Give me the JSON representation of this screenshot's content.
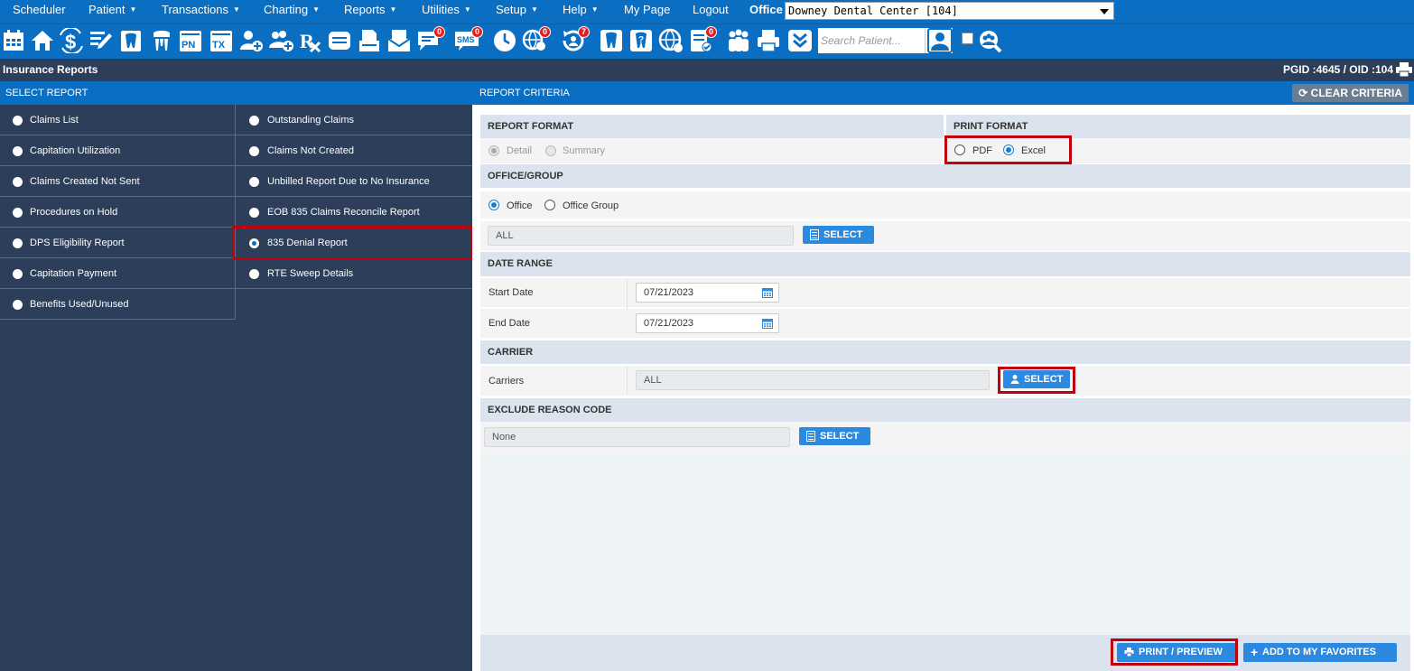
{
  "nav": {
    "items": [
      {
        "label": "Scheduler",
        "caret": false
      },
      {
        "label": "Patient",
        "caret": true
      },
      {
        "label": "Transactions",
        "caret": true
      },
      {
        "label": "Charting",
        "caret": true
      },
      {
        "label": "Reports",
        "caret": true
      },
      {
        "label": "Utilities",
        "caret": true
      },
      {
        "label": "Setup",
        "caret": true
      },
      {
        "label": "Help",
        "caret": true
      },
      {
        "label": "My Page",
        "caret": false
      },
      {
        "label": "Logout",
        "caret": false
      }
    ],
    "office_label": "Office",
    "office_value": "Downey Dental Center [104]"
  },
  "toolbar": {
    "badges": {
      "messages": "0",
      "sms": "0",
      "web": "0",
      "recall": "7",
      "docs": "0"
    },
    "search_placeholder": "Search Patient..."
  },
  "page": {
    "title": "Insurance Reports",
    "pgid_oid": "PGID :4645  /  OID :104"
  },
  "select_report": {
    "header": "SELECT REPORT",
    "col0": [
      "Claims List",
      "Capitation Utilization",
      "Claims Created Not Sent",
      "Procedures on Hold",
      "DPS Eligibility Report",
      "Capitation Payment",
      "Benefits Used/Unused"
    ],
    "col1": [
      "Outstanding Claims",
      "Claims Not Created",
      "Unbilled Report Due to No Insurance",
      "EOB 835 Claims Reconcile Report",
      "835 Denial Report",
      "RTE Sweep Details"
    ],
    "selected": "835 Denial Report"
  },
  "criteria": {
    "header": "REPORT CRITERIA",
    "clear_label": "CLEAR CRITERIA",
    "report_format": {
      "title": "REPORT FORMAT",
      "options": [
        "Detail",
        "Summary"
      ],
      "selected": "Detail"
    },
    "print_format": {
      "title": "PRINT FORMAT",
      "options": [
        "PDF",
        "Excel"
      ],
      "selected": "Excel"
    },
    "office_group": {
      "title": "OFFICE/GROUP",
      "options": [
        "Office",
        "Office Group"
      ],
      "selected": "Office",
      "value": "ALL",
      "select_label": "SELECT"
    },
    "date_range": {
      "title": "DATE RANGE",
      "start_label": "Start Date",
      "start_value": "07/21/2023",
      "end_label": "End Date",
      "end_value": "07/21/2023"
    },
    "carrier": {
      "title": "CARRIER",
      "label": "Carriers",
      "value": "ALL",
      "select_label": "SELECT"
    },
    "exclude_reason": {
      "title": "EXCLUDE REASON CODE",
      "value": "None",
      "select_label": "SELECT"
    },
    "print_preview_label": "PRINT / PREVIEW",
    "favorites_label": "ADD TO MY FAVORITES"
  },
  "colors": {
    "nav_blue": "#0a6fc2",
    "panel_dark": "#2c3e59",
    "button_blue": "#2b8ae0",
    "highlight_red": "#c0000a"
  }
}
